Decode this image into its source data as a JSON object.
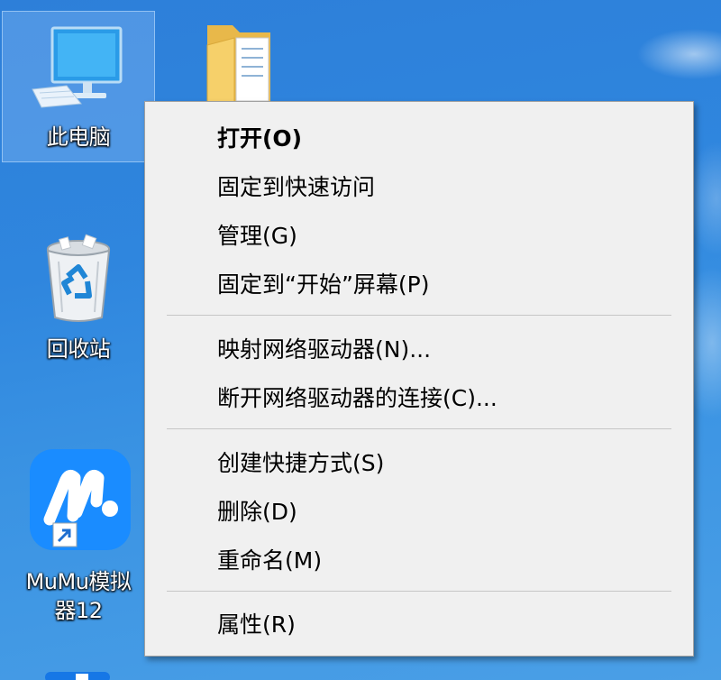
{
  "desktop": {
    "icons": [
      {
        "label": "此电脑",
        "icon": "computer-icon",
        "selected": true
      },
      {
        "label": "",
        "icon": "folder-icon"
      },
      {
        "label": "回收站",
        "icon": "recycle-bin-icon"
      },
      {
        "label_line1": "MuMu模拟",
        "label_line2": "器12",
        "icon": "mumu-app-icon",
        "shortcut": true
      }
    ]
  },
  "context_menu": {
    "items": [
      {
        "label": "打开(O)",
        "bold": true
      },
      {
        "label": "固定到快速访问"
      },
      {
        "label": "管理(G)"
      },
      {
        "label": "固定到“开始”屏幕(P)"
      },
      {
        "label": "映射网络驱动器(N)..."
      },
      {
        "label": "断开网络驱动器的连接(C)..."
      },
      {
        "label": "创建快捷方式(S)"
      },
      {
        "label": "删除(D)"
      },
      {
        "label": "重命名(M)"
      },
      {
        "label": "属性(R)"
      }
    ]
  },
  "colors": {
    "desktop_background": "#2f86de",
    "menu_background": "#f0f0f0",
    "menu_border": "#a0a0a0",
    "separator": "#c6c6c6",
    "mumu_brand": "#1a8cff"
  }
}
